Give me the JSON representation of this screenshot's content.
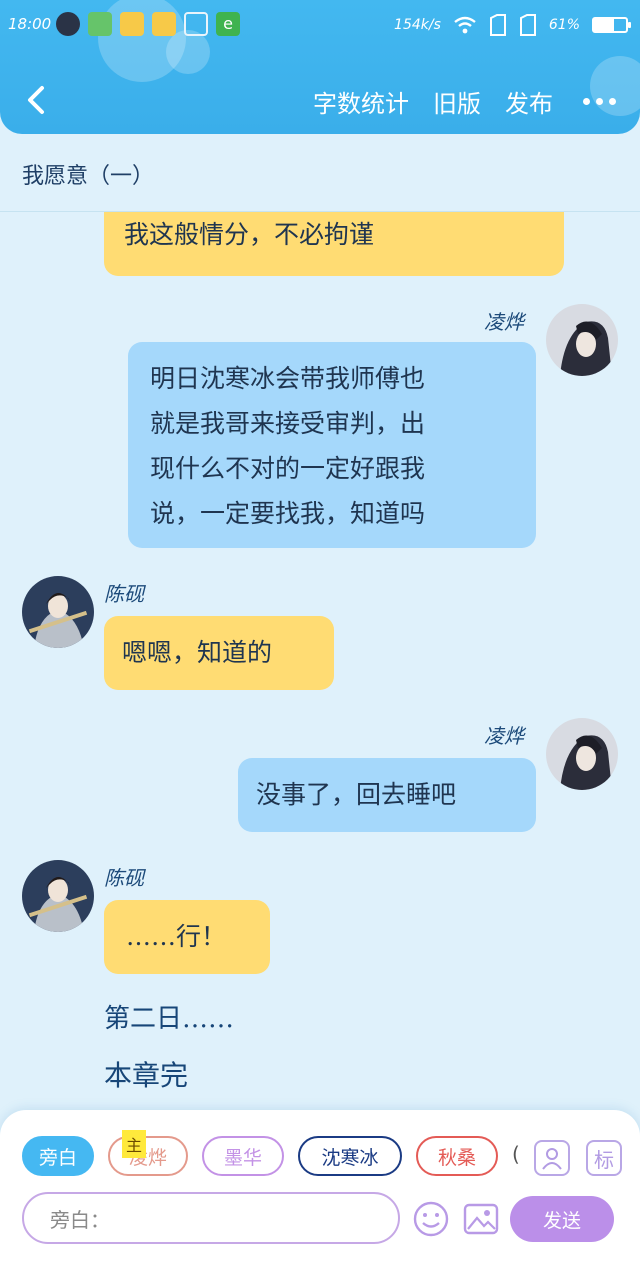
{
  "status_bar": {
    "time": "18:00",
    "net_speed": "154k/s",
    "battery": "61%",
    "battery_level": 0.61
  },
  "header": {
    "back_label": "<",
    "actions": [
      "字数统计",
      "旧版",
      "发布"
    ],
    "more_label": "..."
  },
  "chapter": {
    "title": "我愿意（一）"
  },
  "messages": [
    {
      "side": "left",
      "speaker": "",
      "text": "我这般情分，不必拘谨"
    },
    {
      "side": "right",
      "speaker": "凌烨",
      "lines": [
        "明日沈寒冰会带我师傅也",
        "就是我哥来接受审判，出",
        "现什么不对的一定好跟我",
        "说，一定要找我，知道吗"
      ]
    },
    {
      "side": "left",
      "speaker": "陈砚",
      "text": "嗯嗯，知道的"
    },
    {
      "side": "right",
      "speaker": "凌烨",
      "text": "没事了，回去睡吧"
    },
    {
      "side": "left",
      "speaker": "陈砚",
      "text": "……行！"
    }
  ],
  "narration": [
    "第二日……",
    "本章完"
  ],
  "input_panel": {
    "chips": [
      "旁白",
      "凌烨",
      "墨华",
      "沈寒冰",
      "秋桑",
      "("
    ],
    "chip_colors": [
      "#45b8f2",
      "#e49a8c",
      "#c392e6",
      "#1b3b84",
      "#e45b56",
      "#555555"
    ],
    "main_tag": "主",
    "mark_button": "标",
    "input_placeholder": "旁白：",
    "send_label": "发送"
  }
}
